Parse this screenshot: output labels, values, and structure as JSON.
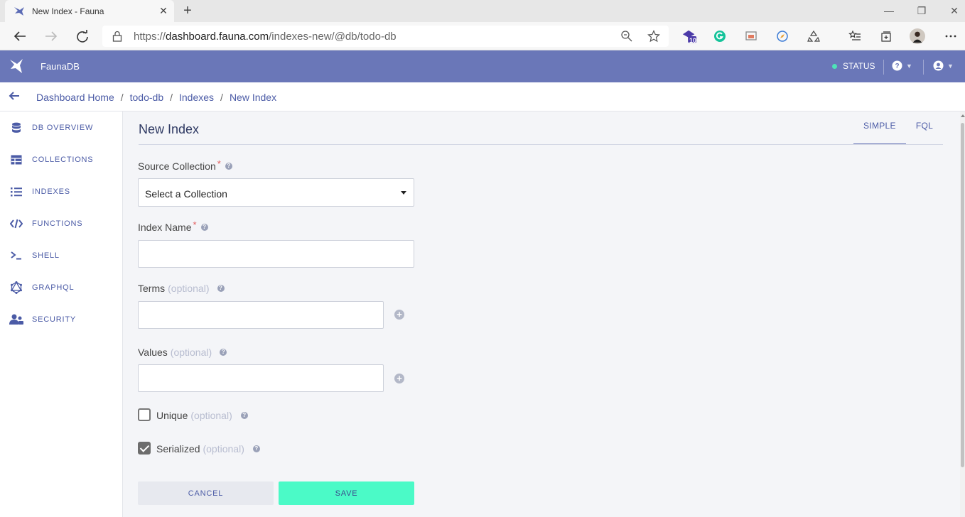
{
  "browser": {
    "tab_title": "New Index - Fauna",
    "url_prefix": "https://",
    "url_host": "dashboard.fauna.com",
    "url_path": "/indexes-new/@db/todo-db",
    "ext_badge": "10"
  },
  "header": {
    "brand": "FaunaDB",
    "status": "STATUS",
    "colors": {
      "header_bg": "#6a77b8",
      "status_dot": "#4ee3b7"
    }
  },
  "breadcrumb": [
    "Dashboard Home",
    "todo-db",
    "Indexes",
    "New Index"
  ],
  "sidebar": {
    "items": [
      {
        "label": "DB OVERVIEW",
        "icon": "database-icon"
      },
      {
        "label": "COLLECTIONS",
        "icon": "table-icon"
      },
      {
        "label": "INDEXES",
        "icon": "list-icon"
      },
      {
        "label": "FUNCTIONS",
        "icon": "code-icon"
      },
      {
        "label": "SHELL",
        "icon": "terminal-icon"
      },
      {
        "label": "GRAPHQL",
        "icon": "graphql-icon"
      },
      {
        "label": "SECURITY",
        "icon": "users-icon"
      }
    ]
  },
  "main": {
    "title": "New Index",
    "tabs": [
      {
        "label": "SIMPLE",
        "active": true
      },
      {
        "label": "FQL",
        "active": false
      }
    ],
    "form": {
      "source_label": "Source Collection",
      "source_value": "Select a Collection",
      "required_mark": "*",
      "index_name_label": "Index Name",
      "index_name_value": "",
      "terms_label": "Terms",
      "values_label": "Values",
      "optional": "(optional)",
      "unique_label": "Unique",
      "unique_checked": false,
      "serialized_label": "Serialized",
      "serialized_checked": true
    },
    "buttons": {
      "cancel": "CANCEL",
      "save": "SAVE"
    },
    "colors": {
      "save_bg": "#4bfac7",
      "accent": "#4b5ba6"
    }
  }
}
